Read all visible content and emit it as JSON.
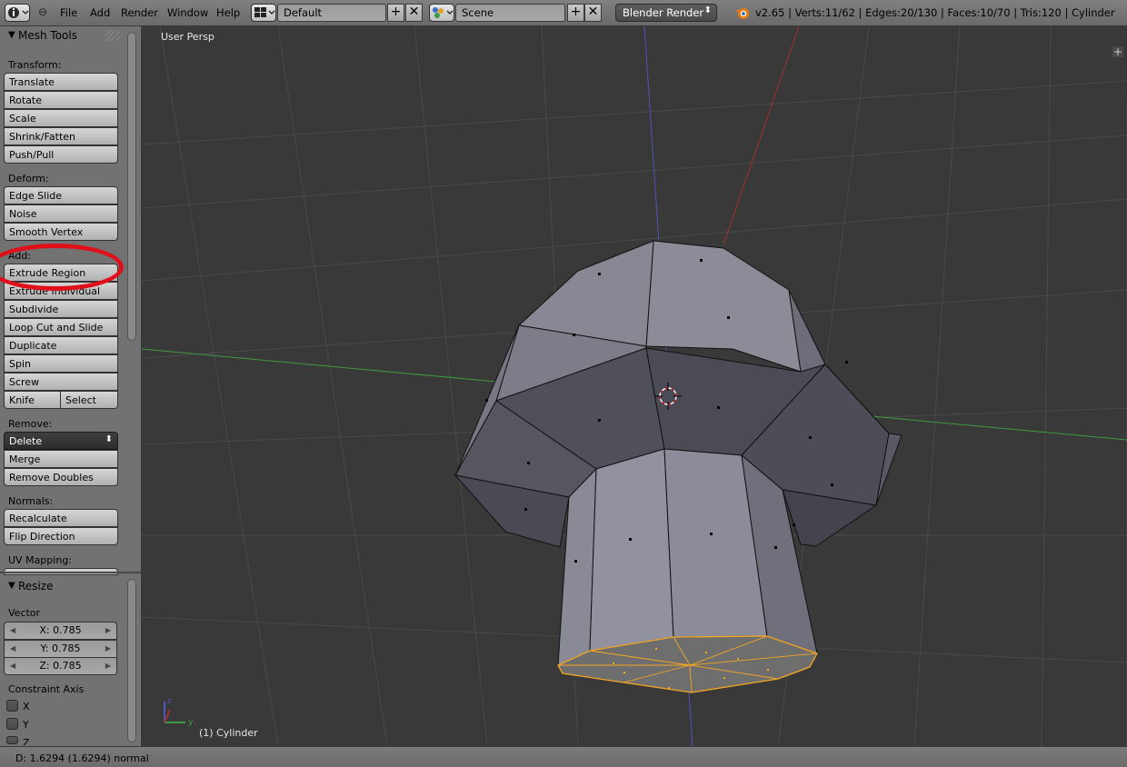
{
  "header": {
    "menus": [
      "File",
      "Add",
      "Render",
      "Window",
      "Help"
    ],
    "screen_layout": "Default",
    "scene": "Scene",
    "render_engine": "Blender Render",
    "stats": "v2.65 | Verts:11/62 | Edges:20/130 | Faces:10/70 | Tris:120 | Cylinder"
  },
  "toolshelf": {
    "mesh_tools_title": "Mesh Tools",
    "transform_label": "Transform:",
    "transform_buttons": [
      "Translate",
      "Rotate",
      "Scale",
      "Shrink/Fatten",
      "Push/Pull"
    ],
    "deform_label": "Deform:",
    "deform_buttons": [
      "Edge Slide",
      "Noise",
      "Smooth Vertex"
    ],
    "add_label": "Add:",
    "add_buttons": [
      "Extrude Region",
      "Extrude Individual",
      "Subdivide",
      "Loop Cut and Slide",
      "Duplicate",
      "Spin",
      "Screw"
    ],
    "knife_label": "Knife",
    "select_label": "Select",
    "remove_label": "Remove:",
    "delete_label": "Delete",
    "remove_buttons": [
      "Merge",
      "Remove Doubles"
    ],
    "normals_label": "Normals:",
    "normals_buttons": [
      "Recalculate",
      "Flip Direction"
    ],
    "uv_label": "UV Mapping:"
  },
  "operator_panel": {
    "title": "Resize",
    "vector_label": "Vector",
    "x": "X: 0.785",
    "y": "Y: 0.785",
    "z": "Z: 0.785",
    "constraint_label": "Constraint Axis",
    "axes": [
      "X",
      "Y",
      "Z"
    ]
  },
  "viewport": {
    "view_label": "User Persp",
    "object_label": "(1) Cylinder"
  },
  "status": {
    "text": "D: 1.6294 (1.6294) normal"
  },
  "colors": {
    "selection_orange": "#f5a623",
    "annotation_red": "#e0101a",
    "x_axis": "#a03030",
    "y_axis": "#3f9a3f",
    "z_axis": "#4e56b8"
  }
}
